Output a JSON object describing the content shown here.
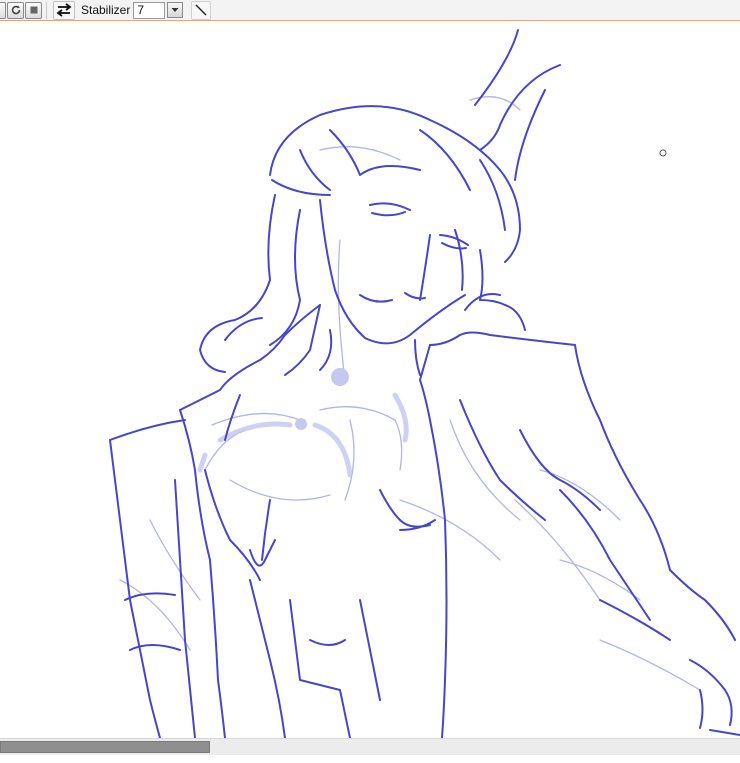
{
  "toolbar": {
    "stabilizer_label": "Stabilizer",
    "stabilizer_value": "7",
    "icons": [
      "rotate-reset-icon",
      "stop-icon",
      "swap-arrows-icon",
      "chevron-down-icon",
      "line-tool-icon"
    ]
  },
  "colors": {
    "toolbar_bg": "#f3f3f3",
    "toolbar_border": "#f4a460",
    "sketch_stroke": "#4646c8",
    "sketch_light": "#9aa0e0",
    "scrollbar_thumb": "#8f8f8f"
  },
  "scrollbar": {
    "horizontal_position": 0.0
  }
}
